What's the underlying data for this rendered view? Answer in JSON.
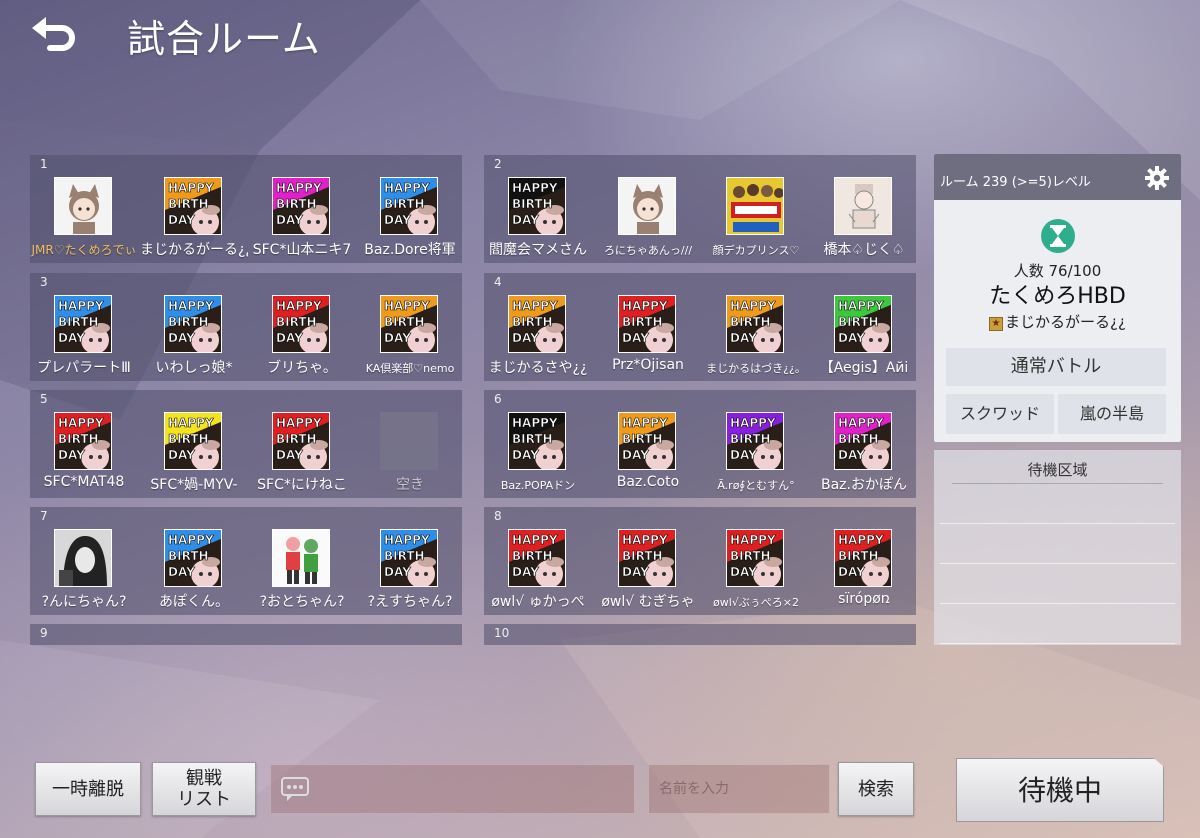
{
  "header": {
    "title": "試合ルーム"
  },
  "teams": [
    {
      "number": "1",
      "players": [
        {
          "name": "JMR♡たくめろでぃ",
          "avatar": "chibi-fox",
          "name_style": "gold"
        },
        {
          "name": "まじかるがーる¿¿",
          "avatar": "hb-orange",
          "name_style": ""
        },
        {
          "name": "SFC*山本ニキ7",
          "avatar": "hb-magenta",
          "name_style": ""
        },
        {
          "name": "Baz.Dore将軍",
          "avatar": "hb-blue",
          "name_style": ""
        }
      ]
    },
    {
      "number": "2",
      "players": [
        {
          "name": "閻魔会マメさん",
          "avatar": "hb-black",
          "name_style": ""
        },
        {
          "name": "ろにちゃあんっ///",
          "avatar": "chibi-fox",
          "name_style": "small"
        },
        {
          "name": "顔デカプリンス♡",
          "avatar": "poster",
          "name_style": "small"
        },
        {
          "name": "橋本♤じく♤",
          "avatar": "sketch",
          "name_style": ""
        }
      ]
    },
    {
      "number": "3",
      "players": [
        {
          "name": "プレパラートⅢ",
          "avatar": "hb-blue",
          "name_style": ""
        },
        {
          "name": "いわしっ娘*",
          "avatar": "hb-blue",
          "name_style": ""
        },
        {
          "name": "ブリちゃ。",
          "avatar": "hb-red",
          "name_style": ""
        },
        {
          "name": "KA倶楽部♡nemo",
          "avatar": "hb-orange",
          "name_style": "small"
        }
      ]
    },
    {
      "number": "4",
      "players": [
        {
          "name": "まじかるさや¿¿",
          "avatar": "hb-orange",
          "name_style": ""
        },
        {
          "name": "Prz*Ojisan",
          "avatar": "hb-red",
          "name_style": ""
        },
        {
          "name": "まじかるはづき¿¿。",
          "avatar": "hb-orange",
          "name_style": "small"
        },
        {
          "name": "【Aegis】Aйi",
          "avatar": "hb-green",
          "name_style": ""
        }
      ]
    },
    {
      "number": "5",
      "players": [
        {
          "name": "SFC*MAT48",
          "avatar": "hb-red",
          "name_style": ""
        },
        {
          "name": "SFC*媧-MYV-",
          "avatar": "hb-yellow",
          "name_style": ""
        },
        {
          "name": "SFC*にけねこ",
          "avatar": "hb-red",
          "name_style": ""
        },
        {
          "name": "空き",
          "avatar": "empty",
          "name_style": "empty"
        }
      ]
    },
    {
      "number": "6",
      "players": [
        {
          "name": "Baz.POPAドン",
          "avatar": "hb-black",
          "name_style": "small"
        },
        {
          "name": "Baz.Coto",
          "avatar": "hb-orange",
          "name_style": ""
        },
        {
          "name": "Ã.rø∮とむすん°",
          "avatar": "hb-purple",
          "name_style": "small"
        },
        {
          "name": "Baz.おかぽん",
          "avatar": "hb-magenta",
          "name_style": ""
        }
      ]
    },
    {
      "number": "7",
      "players": [
        {
          "name": "?んにちゃん?",
          "avatar": "mono",
          "name_style": ""
        },
        {
          "name": "あぽくん。",
          "avatar": "hb-blue",
          "name_style": ""
        },
        {
          "name": "?おとちゃん?",
          "avatar": "duo",
          "name_style": ""
        },
        {
          "name": "?えすちゃん?",
          "avatar": "hb-blue",
          "name_style": ""
        }
      ]
    },
    {
      "number": "8",
      "players": [
        {
          "name": "øwl√ ゅかっぺ",
          "avatar": "hb-red",
          "name_style": ""
        },
        {
          "name": "øwl√ むぎちゃ",
          "avatar": "hb-red",
          "name_style": ""
        },
        {
          "name": "øwl√ぶぅぺろ×2",
          "avatar": "hb-red",
          "name_style": "small"
        },
        {
          "name": "sïrópøռ",
          "avatar": "hb-red",
          "name_style": ""
        }
      ]
    },
    {
      "number": "9",
      "players": []
    },
    {
      "number": "10",
      "players": []
    }
  ],
  "room": {
    "header": "ルーム 239 (>=5)レベル",
    "count": "人数 76/100",
    "name": "たくめろHBD",
    "host": "まじかるがーる¿¿",
    "mode": "通常バトル",
    "team_type": "スクワッド",
    "map": "嵐の半島"
  },
  "waiting_area": {
    "title": "待機区域"
  },
  "bottom": {
    "leave": "一時離脱",
    "spectate_line1": "観戦",
    "spectate_line2": "リスト",
    "search_placeholder": "名前を入力",
    "search": "検索",
    "waiting": "待機中"
  },
  "hb_text": [
    "HAPPY",
    "BIRTH",
    "DAY"
  ],
  "colors": {
    "hb-orange": "#f09a1c",
    "hb-magenta": "#e020c8",
    "hb-blue": "#2f8ee8",
    "hb-black": "#111111",
    "hb-red": "#e02020",
    "hb-green": "#3cc83c",
    "hb-yellow": "#f5e41c",
    "hb-purple": "#8a1ee0"
  }
}
